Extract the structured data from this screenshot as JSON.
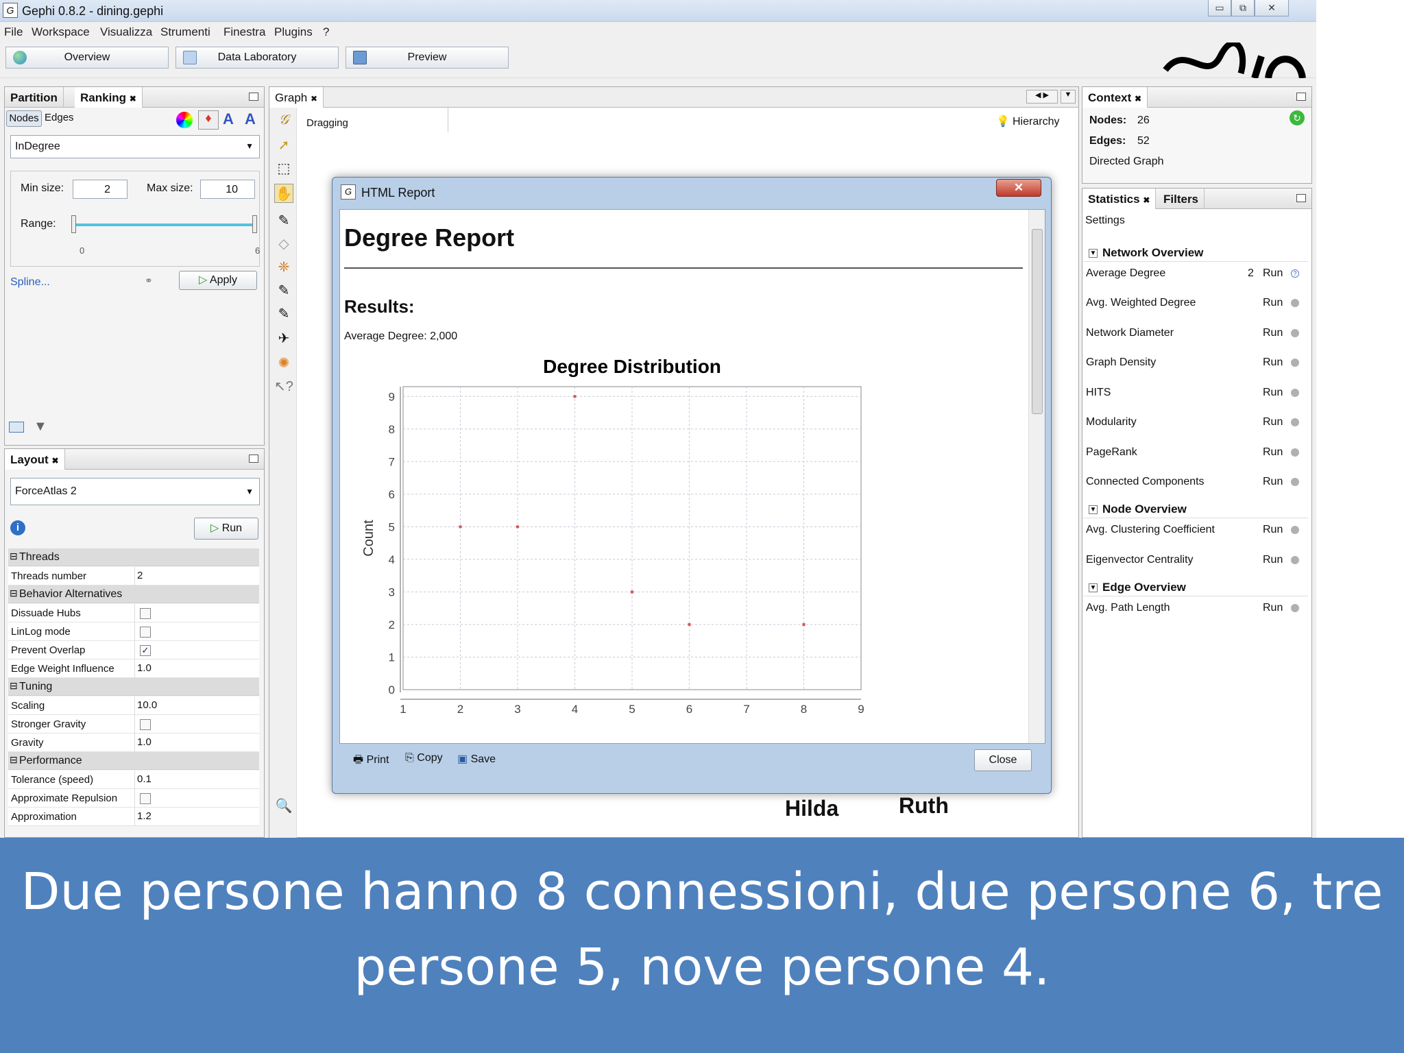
{
  "window": {
    "title": "Gephi 0.8.2 - dining.gephi",
    "btn_min": "▭",
    "btn_max": "⧉",
    "btn_close": "✕"
  },
  "menu": [
    "File",
    "Workspace",
    "Visualizza",
    "Strumenti",
    "Finestra",
    "Plugins",
    "?"
  ],
  "toolbar": {
    "overview": "Overview",
    "datalab": "Data Laboratory",
    "preview": "Preview"
  },
  "ranking": {
    "tab_partition": "Partition",
    "tab_ranking": "Ranking",
    "nodes": "Nodes",
    "edges": "Edges",
    "attribute": "InDegree",
    "min_label": "Min size:",
    "min_value": "2",
    "max_label": "Max size:",
    "max_value": "10",
    "range_label": "Range:",
    "range_min": "0",
    "range_max": "6",
    "spline": "Spline...",
    "apply": "Apply"
  },
  "layout": {
    "tab": "Layout",
    "algorithm": "ForceAtlas 2",
    "run": "Run",
    "props": [
      {
        "type": "cat",
        "label": "Threads"
      },
      {
        "type": "row",
        "label": "Threads number",
        "value": "2"
      },
      {
        "type": "cat",
        "label": "Behavior Alternatives"
      },
      {
        "type": "chk",
        "label": "Dissuade Hubs",
        "checked": false
      },
      {
        "type": "chk",
        "label": "LinLog mode",
        "checked": false
      },
      {
        "type": "chk",
        "label": "Prevent Overlap",
        "checked": true
      },
      {
        "type": "row",
        "label": "Edge Weight Influence",
        "value": "1.0"
      },
      {
        "type": "cat",
        "label": "Tuning"
      },
      {
        "type": "row",
        "label": "Scaling",
        "value": "10.0"
      },
      {
        "type": "chk",
        "label": "Stronger Gravity",
        "checked": false
      },
      {
        "type": "row",
        "label": "Gravity",
        "value": "1.0"
      },
      {
        "type": "cat",
        "label": "Performance"
      },
      {
        "type": "row",
        "label": "Tolerance (speed)",
        "value": "0.1"
      },
      {
        "type": "chk",
        "label": "Approximate Repulsion",
        "checked": false
      },
      {
        "type": "row",
        "label": "Approximation",
        "value": "1.2"
      }
    ]
  },
  "graph": {
    "tab": "Graph",
    "mode": "Dragging",
    "hierarchy": "Hierarchy",
    "node_hilda": "Hilda",
    "node_ruth": "Ruth"
  },
  "context": {
    "tab": "Context",
    "nodes_label": "Nodes:",
    "nodes_value": "26",
    "edges_label": "Edges:",
    "edges_value": "52",
    "graph_type": "Directed Graph"
  },
  "statistics": {
    "tab_stats": "Statistics",
    "tab_filters": "Filters",
    "settings": "Settings",
    "run": "Run",
    "net_header": "Network Overview",
    "avg_degree_label": "Average Degree",
    "avg_degree_value": "2",
    "network": [
      "Avg. Weighted Degree",
      "Network Diameter",
      "Graph Density",
      "HITS",
      "Modularity",
      "PageRank",
      "Connected Components"
    ],
    "node_header": "Node Overview",
    "node": [
      "Avg. Clustering Coefficient",
      "Eigenvector Centrality"
    ],
    "edge_header": "Edge Overview",
    "edge": [
      "Avg. Path Length"
    ]
  },
  "report": {
    "title": "HTML Report",
    "heading": "Degree Report",
    "results": "Results:",
    "avg": "Average Degree: 2,000",
    "print": "Print",
    "copy": "Copy",
    "save": "Save",
    "close": "Close"
  },
  "chart_data": {
    "type": "scatter",
    "title": "Degree Distribution",
    "xlabel": "",
    "ylabel": "Count",
    "xlim": [
      1,
      9
    ],
    "ylim": [
      0,
      9.3
    ],
    "x": [
      2,
      3,
      4,
      5,
      6,
      8
    ],
    "y": [
      5,
      5,
      9,
      3,
      2,
      2
    ],
    "xticks": [
      "1",
      "2",
      "3",
      "4",
      "5",
      "6",
      "7",
      "8",
      "9"
    ],
    "yticks": [
      "0",
      "1",
      "2",
      "3",
      "4",
      "5",
      "6",
      "7",
      "8",
      "9"
    ],
    "grid": true,
    "point_color": "#e05050"
  },
  "caption": {
    "line1": "Due persone hanno 8 connessioni, due persone 6, tre",
    "line2": "persone 5, nove persone 4."
  }
}
